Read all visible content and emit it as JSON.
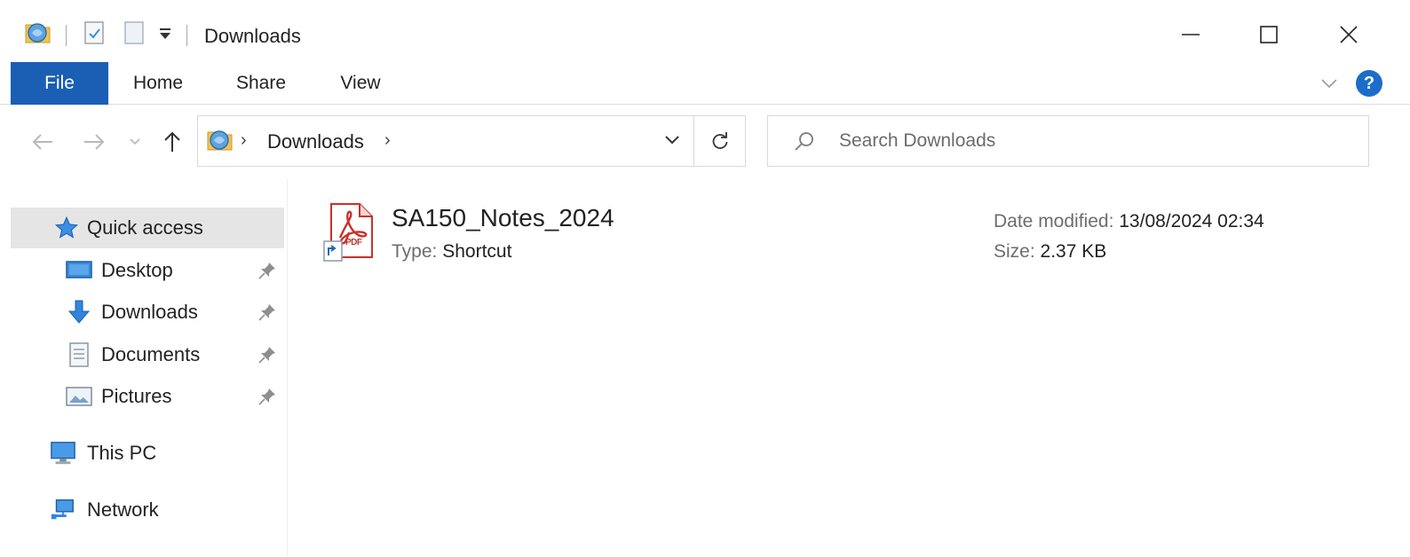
{
  "window": {
    "title": "Downloads",
    "controls": {
      "minimize": "—",
      "maximize": "☐",
      "close": "✕"
    }
  },
  "ribbon": {
    "tabs": [
      {
        "label": "File"
      },
      {
        "label": "Home"
      },
      {
        "label": "Share"
      },
      {
        "label": "View"
      }
    ],
    "help": "?"
  },
  "address": {
    "crumb": "Downloads"
  },
  "search": {
    "placeholder": "Search Downloads"
  },
  "sidebar": {
    "quick_access": "Quick access",
    "items": [
      {
        "label": "Desktop"
      },
      {
        "label": "Downloads"
      },
      {
        "label": "Documents"
      },
      {
        "label": "Pictures"
      }
    ],
    "this_pc": "This PC",
    "network": "Network"
  },
  "file": {
    "name": "SA150_Notes_2024",
    "type_label": "Type:",
    "type_value": "Shortcut",
    "date_label": "Date modified:",
    "date_value": "13/08/2024 02:34",
    "size_label": "Size:",
    "size_value": "2.37 KB",
    "icon_text": "PDF"
  },
  "colors": {
    "accent": "#1a5fb4",
    "selected_bg": "#e5e5e5",
    "pdf_red": "#c8322b"
  }
}
